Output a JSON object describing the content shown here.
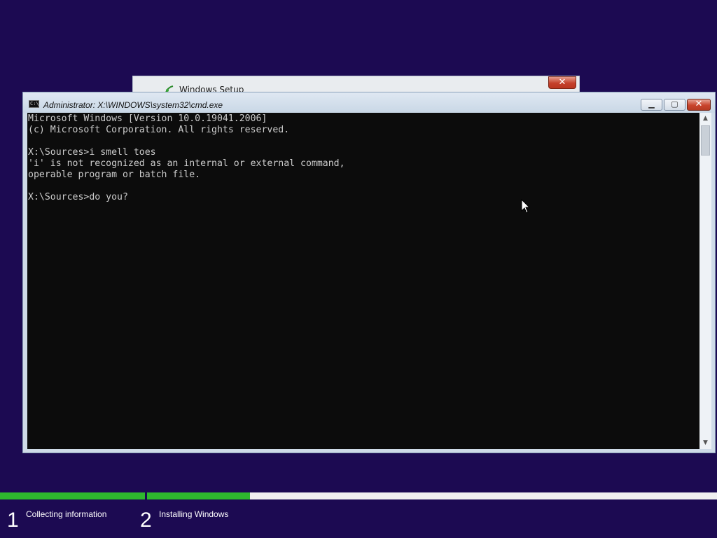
{
  "setup_window": {
    "title": "Windows Setup",
    "close_glyph": "✕"
  },
  "cmd_window": {
    "title": "Administrator: X:\\WINDOWS\\system32\\cmd.exe",
    "icon_text": "C:\\",
    "controls": {
      "minimize": "▁",
      "maximize": "▢",
      "close": "✕"
    },
    "lines": [
      "Microsoft Windows [Version 10.0.19041.2006]",
      "(c) Microsoft Corporation. All rights reserved.",
      "",
      "X:\\Sources>i smell toes",
      "'i' is not recognized as an internal or external command,",
      "operable program or batch file.",
      "",
      "X:\\Sources>do you?"
    ],
    "scroll_up": "▲",
    "scroll_down": "▼"
  },
  "progress": {
    "steps": [
      {
        "number": "1",
        "label": "Collecting information",
        "progress": 1.0
      },
      {
        "number": "2",
        "label": "Installing Windows",
        "progress": 0.18
      }
    ]
  },
  "colors": {
    "desktop_bg": "#1c0a52",
    "console_bg": "#0c0c0c",
    "console_text": "#cccccc",
    "progress_fill": "#2eb82e"
  }
}
